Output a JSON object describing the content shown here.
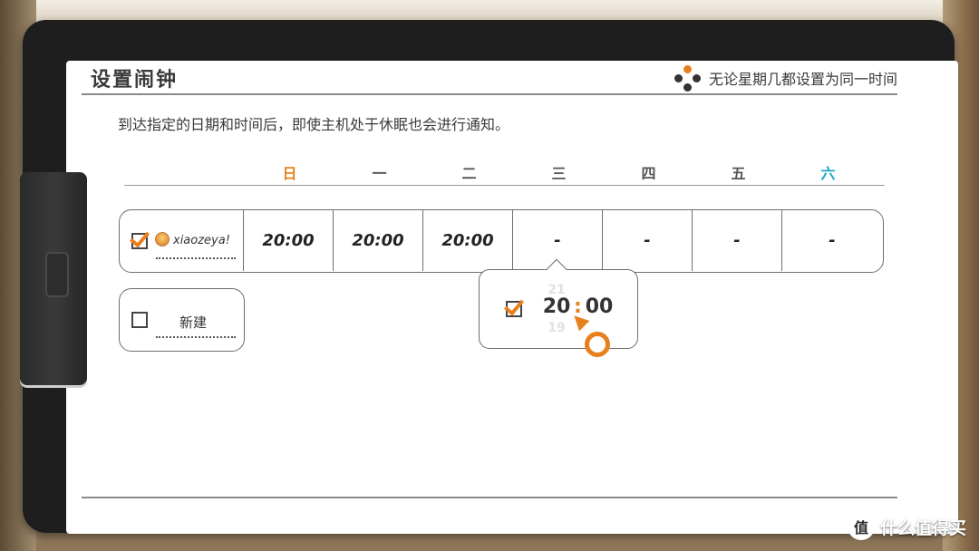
{
  "header": {
    "title": "设置闹钟",
    "hint": "无论星期几都设置为同一时间",
    "hint_icon": "dpad-icon"
  },
  "description": "到达指定的日期和时间后，即使主机处于休眠也会进行通知。",
  "weekdays": [
    "日",
    "一",
    "二",
    "三",
    "四",
    "五",
    "六"
  ],
  "colors": {
    "accent": "#e8801d",
    "saturday": "#1fa6c9"
  },
  "alarm_rows": [
    {
      "user": "xiaozeya!",
      "enabled": true,
      "times": [
        "20:00",
        "20:00",
        "20:00",
        "-",
        "-",
        "-",
        "-"
      ]
    }
  ],
  "new_row": {
    "label": "新建",
    "checked": false
  },
  "popup": {
    "checked": true,
    "hour": "20",
    "hour_above": "21",
    "hour_below": "19",
    "separator": ":",
    "minute": "00"
  },
  "watermark": {
    "badge": "值",
    "text": "什么值得买"
  }
}
